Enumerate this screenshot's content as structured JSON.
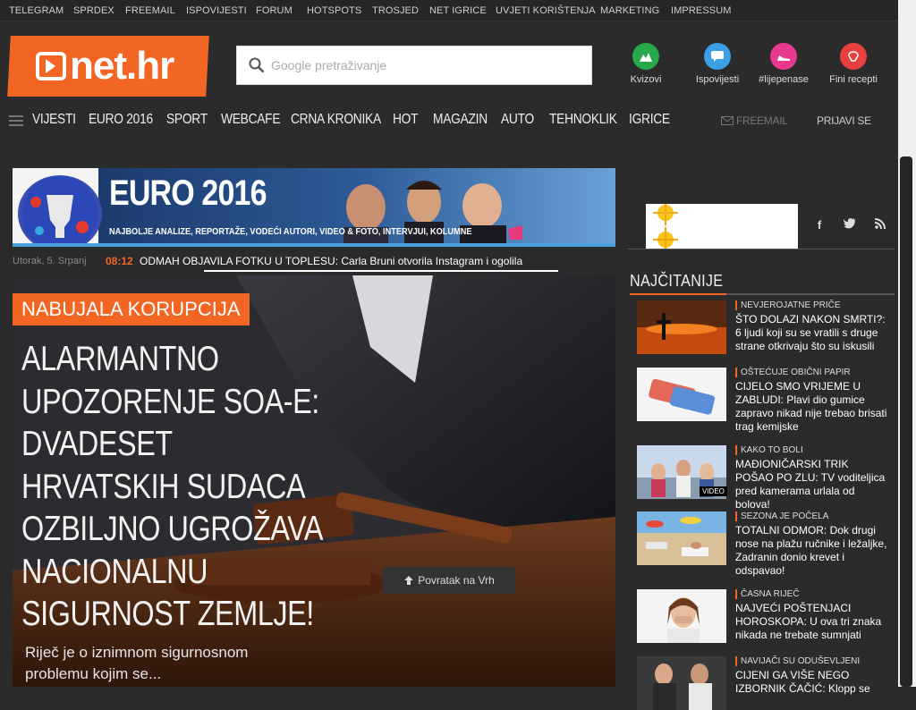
{
  "topbar": {
    "links": [
      "TELEGRAM",
      "SPRDEX",
      "FREEMAIL",
      "ISPOVIJESTI",
      "FORUM",
      "HOTSPOTS",
      "TROSJED",
      "NET IGRICE",
      "UVJETI KORIŠTENJA",
      "MARKETING",
      "IMPRESSUM"
    ]
  },
  "logo": {
    "text": "net.hr"
  },
  "search": {
    "placeholder": "Google pretraživanje"
  },
  "quick_links": [
    {
      "label": "Kvizovi",
      "icon": "quiz-icon",
      "color": "#27a84a"
    },
    {
      "label": "Ispovijesti",
      "icon": "chat-icon",
      "color": "#3ba0e6"
    },
    {
      "label": "#lijepenase",
      "icon": "heel-icon",
      "color": "#e8398f"
    },
    {
      "label": "Fini recepti",
      "icon": "recipe-icon",
      "color": "#e84040"
    }
  ],
  "nav": {
    "items": [
      "VIJESTI",
      "EURO 2016",
      "SPORT",
      "WEBCAFE",
      "CRNA KRONIKA",
      "HOT",
      "MAGAZIN",
      "AUTO",
      "TEHNOKLIK",
      "IGRICE"
    ],
    "freemail": "FREEMAIL",
    "login": "PRIJAVI SE"
  },
  "banner": {
    "title": "EURO 2016",
    "subtitle": "NAJBOLJE ANALIZE, REPORTAŽE, VODEĆI AUTORI, VIDEO & FOTO, INTERVJUI, KOLUMNE"
  },
  "ticker": {
    "date": "Utorak, 5. Srpanj",
    "time": "08:12",
    "text": "ODMAH OBJAVILA FOTKU U TOPLESU: Carla Bruni otvorila Instagram i ogolila"
  },
  "hero": {
    "tag": "NABUJALA KORUPCIJA",
    "title": "ALARMANTNO UPOZORENJE SOA-E: DVADESET HRVATSKIH SUDACA OZBILJNO UGROŽAVA NACIONALNU SIGURNOST ZEMLJE!",
    "lead": "Riječ je o iznimnom sigurnosnom problemu kojim se..."
  },
  "back_to_top": "Povratak na Vrh",
  "sidebar": {
    "title": "NAJČITANIJE",
    "items": [
      {
        "category": "NEVJEROJATNE PRIČE",
        "title": "ŠTO DOLAZI NAKON SMRTI?: 6 ljudi koji su se vratili s druge strane otkrivaju što su iskusili",
        "video": ""
      },
      {
        "category": "OŠTEĆUJE OBIČNI PAPIR",
        "title": "CIJELO SMO VRIJEME U ZABLUDI: Plavi dio gumice zapravo nikad nije trebao brisati trag kemijske",
        "video": ""
      },
      {
        "category": "KAKO TO BOLI",
        "title": "MAĐIONIČARSKI TRIK POŠAO PO ZLU: TV voditeljica pred kamerama urlala od bolova!",
        "video": "VIDEO"
      },
      {
        "category": "SEZONA JE POČELA",
        "title": "TOTALNI ODMOR: Dok drugi nose na plažu ručnike i ležaljke, Zadranin donio krevet i odspavao!",
        "video": ""
      },
      {
        "category": "ČASNA RIJEČ",
        "title": "NAJVEĆI POŠTENJACI HOROSKOPA: U ova tri znaka nikada ne trebate sumnjati",
        "video": ""
      },
      {
        "category": "NAVIJAČI SU ODUŠEVLJENI",
        "title": "CIJENI GA VIŠE NEGO IZBORNIK ČAČIĆ: Klopp se",
        "video": ""
      }
    ]
  }
}
